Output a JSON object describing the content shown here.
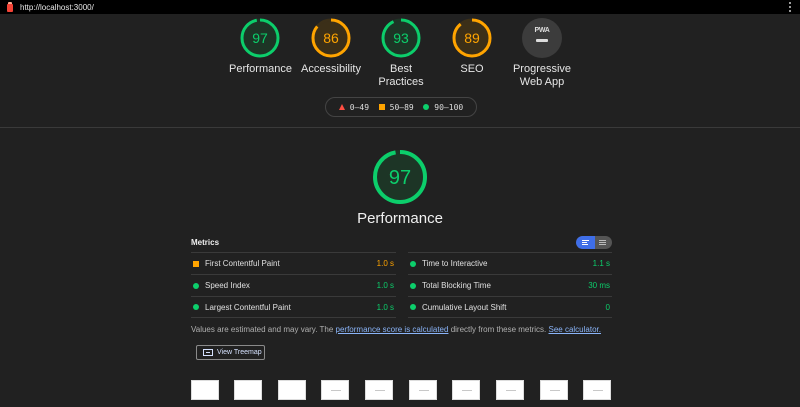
{
  "address_bar": {
    "url": "http://localhost:3000/"
  },
  "categories": [
    {
      "score": "97",
      "label": "Performance",
      "color": "#0cce6b",
      "fraction": 0.97
    },
    {
      "score": "86",
      "label": "Accessibility",
      "color": "#ffa400",
      "fraction": 0.86
    },
    {
      "score": "93",
      "label": "Best Practices",
      "color": "#0cce6b",
      "fraction": 0.93
    },
    {
      "score": "89",
      "label": "SEO",
      "color": "#ffa400",
      "fraction": 0.89
    },
    {
      "badge": "PWA",
      "label_line1": "Progressive",
      "label_line2": "Web App"
    }
  ],
  "legend": {
    "fail": "0–49",
    "average": "50–89",
    "pass": "90–100"
  },
  "performance": {
    "score": "97",
    "title": "Performance",
    "fraction": 0.97,
    "color": "#0cce6b"
  },
  "metrics": {
    "heading": "Metrics",
    "left": [
      {
        "name": "First Contentful Paint",
        "value": "1.0 s",
        "status": "average"
      },
      {
        "name": "Speed Index",
        "value": "1.0 s",
        "status": "pass"
      },
      {
        "name": "Largest Contentful Paint",
        "value": "1.0 s",
        "status": "pass"
      }
    ],
    "right": [
      {
        "name": "Time to Interactive",
        "value": "1.1 s",
        "status": "pass"
      },
      {
        "name": "Total Blocking Time",
        "value": "30 ms",
        "status": "pass"
      },
      {
        "name": "Cumulative Layout Shift",
        "value": "0",
        "status": "pass"
      }
    ]
  },
  "note": {
    "prefix": "Values are estimated and may vary. The ",
    "link1": "performance score is calculated",
    "middle": " directly from these metrics. ",
    "link2": "See calculator."
  },
  "treemap_button": {
    "label": "View Treemap"
  },
  "colors": {
    "pass": "#0cce6b",
    "average": "#ffa400",
    "fail": "#ff4e42"
  }
}
